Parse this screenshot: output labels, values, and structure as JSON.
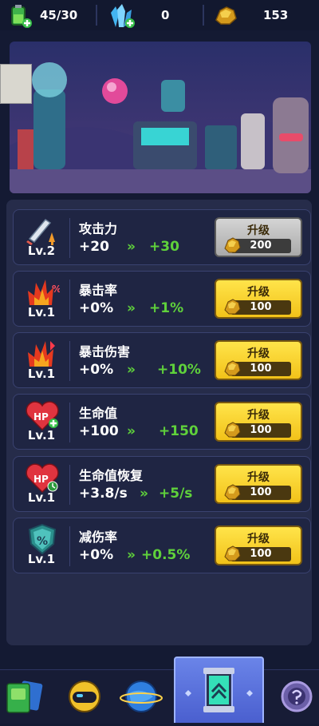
{
  "resources": {
    "energy": "45/30",
    "crystals": "0",
    "gold": "153"
  },
  "upgrades": [
    {
      "name": "攻击力",
      "level": "Lv.2",
      "current": "+20",
      "next": "+30",
      "button": "升级",
      "cost": "200",
      "enabled": false,
      "icon": "sword-attack-icon"
    },
    {
      "name": "暴击率",
      "level": "Lv.1",
      "current": "+0%",
      "next": "+1%",
      "button": "升级",
      "cost": "100",
      "enabled": true,
      "icon": "crit-rate-icon"
    },
    {
      "name": "暴击伤害",
      "level": "Lv.1",
      "current": "+0%",
      "next": "+10%",
      "button": "升级",
      "cost": "100",
      "enabled": true,
      "icon": "crit-damage-icon"
    },
    {
      "name": "生命值",
      "level": "Lv.1",
      "current": "+100",
      "next": "+150",
      "button": "升级",
      "cost": "100",
      "enabled": true,
      "icon": "hp-heart-icon"
    },
    {
      "name": "生命值恢复",
      "level": "Lv.1",
      "current": "+3.8/s",
      "next": "+5/s",
      "button": "升级",
      "cost": "100",
      "enabled": true,
      "icon": "hp-regen-icon"
    },
    {
      "name": "减伤率",
      "level": "Lv.1",
      "current": "+0%",
      "next": "+0.5%",
      "button": "升级",
      "cost": "100",
      "enabled": true,
      "icon": "damage-reduction-shield-icon"
    }
  ],
  "arrow": "»",
  "hp_label": "HP",
  "percent_label": "%",
  "nav": [
    "cards-icon",
    "helmet-icon",
    "planet-icon",
    "upgrade-station-icon",
    "locked-mystery-icon"
  ],
  "colors": {
    "gold_button": "#f5cf1f",
    "gray_button": "#bdbdbd",
    "bonus_green": "#5fd13b",
    "panel": "#262c4a"
  }
}
